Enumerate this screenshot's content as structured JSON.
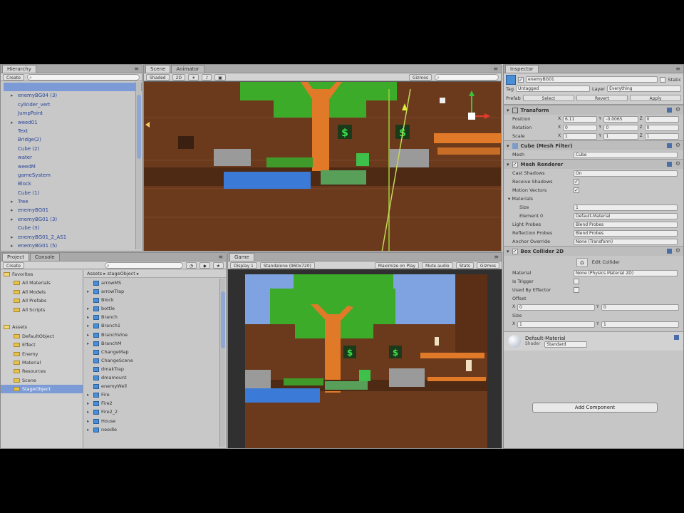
{
  "hierarchy": {
    "tab": "Hierarchy",
    "create": "Create",
    "search_placeholder": "",
    "items": [
      {
        "label": "",
        "arrow": false,
        "selected": true
      },
      {
        "label": "enemyBG04 (3)",
        "arrow": true,
        "selected": false
      },
      {
        "label": "cylinder_vert",
        "arrow": false,
        "selected": false
      },
      {
        "label": "JumpPoint",
        "arrow": false,
        "selected": false
      },
      {
        "label": "weed01",
        "arrow": true,
        "selected": false
      },
      {
        "label": "Text",
        "arrow": false,
        "selected": false
      },
      {
        "label": "Bridge(2)",
        "arrow": false,
        "selected": false
      },
      {
        "label": "Cube (2)",
        "arrow": false,
        "selected": false
      },
      {
        "label": "water",
        "arrow": false,
        "selected": false
      },
      {
        "label": "weedM",
        "arrow": false,
        "selected": false
      },
      {
        "label": "gameSystem",
        "arrow": false,
        "selected": false
      },
      {
        "label": "Block",
        "arrow": false,
        "selected": false
      },
      {
        "label": "Cube (1)",
        "arrow": false,
        "selected": false
      },
      {
        "label": "Tree",
        "arrow": true,
        "selected": false
      },
      {
        "label": "enemyBG01",
        "arrow": true,
        "selected": false
      },
      {
        "label": "enemyBG01 (3)",
        "arrow": true,
        "selected": false
      },
      {
        "label": "Cube (3)",
        "arrow": false,
        "selected": false
      },
      {
        "label": "enemyBG01_2_AS1",
        "arrow": true,
        "selected": false
      },
      {
        "label": "enemyBG01 (5)",
        "arrow": true,
        "selected": false
      }
    ]
  },
  "scene": {
    "tabs": [
      "Scene",
      "Animator"
    ],
    "shading": "Shaded",
    "mode_2d": "2D",
    "gizmos": "Gizmos"
  },
  "project": {
    "tabs": [
      "Project",
      "Console"
    ],
    "create": "Create",
    "favorites": [
      {
        "label": "Favorites",
        "level": 0,
        "selected": false
      },
      {
        "label": "All Materials",
        "level": 1,
        "selected": false
      },
      {
        "label": "All Models",
        "level": 1,
        "selected": false
      },
      {
        "label": "All Prefabs",
        "level": 1,
        "selected": false
      },
      {
        "label": "All Scripts",
        "level": 1,
        "selected": false
      },
      {
        "label": "",
        "level": 0,
        "selected": false
      },
      {
        "label": "Assets",
        "level": 0,
        "selected": false
      },
      {
        "label": "DefaultObject",
        "level": 1,
        "selected": false
      },
      {
        "label": "Effect",
        "level": 1,
        "selected": false
      },
      {
        "label": "Enemy",
        "level": 1,
        "selected": false
      },
      {
        "label": "Material",
        "level": 1,
        "selected": false
      },
      {
        "label": "Resources",
        "level": 1,
        "selected": false
      },
      {
        "label": "Scene",
        "level": 1,
        "selected": false
      },
      {
        "label": "StageObject",
        "level": 1,
        "selected": true
      }
    ],
    "breadcrumb": "Assets ▸ stageObject ▸",
    "assets": [
      {
        "label": "arrowMS",
        "arrow": false
      },
      {
        "label": "arrowTrap",
        "arrow": true
      },
      {
        "label": "Block",
        "arrow": false
      },
      {
        "label": "bottle",
        "arrow": true
      },
      {
        "label": "Branch",
        "arrow": true
      },
      {
        "label": "Branch1",
        "arrow": true
      },
      {
        "label": "BranchVine",
        "arrow": true
      },
      {
        "label": "BranchM",
        "arrow": true
      },
      {
        "label": "ChangeMap",
        "arrow": false
      },
      {
        "label": "ChangeScene",
        "arrow": false
      },
      {
        "label": "dmakTrap",
        "arrow": false
      },
      {
        "label": "dmamount",
        "arrow": false
      },
      {
        "label": "enemyWell",
        "arrow": false
      },
      {
        "label": "Fire",
        "arrow": true
      },
      {
        "label": "Fire2",
        "arrow": true
      },
      {
        "label": "Fire2_2",
        "arrow": true
      },
      {
        "label": "House",
        "arrow": true
      },
      {
        "label": "needle",
        "arrow": true
      }
    ]
  },
  "game": {
    "tab": "Game",
    "display": "Display 1",
    "aspect": "Standalone (960x720)",
    "toggles": [
      "Maximize on Play",
      "Mute audio",
      "Stats",
      "Gizmos"
    ]
  },
  "inspector": {
    "tab": "Inspector",
    "object_name": "enemyBG01",
    "static_label": "Static",
    "tag_label": "Tag",
    "tag_value": "Untagged",
    "layer_label": "Layer",
    "layer_value": "Everything",
    "prefab_label": "Prefab",
    "prefab_buttons": [
      "Select",
      "Revert",
      "Apply"
    ],
    "transform": {
      "title": "Transform",
      "rows": [
        {
          "label": "Position",
          "x": "6.11",
          "y": "-0.0065",
          "z": "0"
        },
        {
          "label": "Rotation",
          "x": "0",
          "y": "0",
          "z": "0"
        },
        {
          "label": "Scale",
          "x": "1",
          "y": "1",
          "z": "1"
        }
      ]
    },
    "mesh_filter": {
      "title": "Cube (Mesh Filter)",
      "mesh_label": "Mesh",
      "mesh_value": "Cube"
    },
    "mesh_renderer": {
      "title": "Mesh Renderer",
      "cast_shadows_label": "Cast Shadows",
      "cast_shadows_value": "On",
      "receive_shadows_label": "Receive Shadows",
      "motion_vectors_label": "Motion Vectors",
      "materials_label": "Materials",
      "size_label": "Size",
      "size_value": "1",
      "element_label": "Element 0",
      "element_value": "Default-Material",
      "light_probes_label": "Light Probes",
      "light_probes_value": "Blend Probes",
      "reflection_probes_label": "Reflection Probes",
      "reflection_probes_value": "Blend Probes",
      "anchor_label": "Anchor Override",
      "anchor_value": "None (Transform)"
    },
    "box_collider": {
      "title": "Box Collider 2D",
      "edit_label": "Edit Collider",
      "material_label": "Material",
      "material_value": "None (Physics Material 2D)",
      "trigger_label": "Is Trigger",
      "effector_label": "Used By Effector",
      "offset_label": "Offset",
      "offset_x": "0",
      "offset_y": "0",
      "size_label": "Size",
      "size_x": "1",
      "size_y": "1"
    },
    "material": {
      "title": "Default-Material",
      "shader_label": "Shader",
      "shader_value": "Standard"
    },
    "add_component": "Add Component"
  },
  "colors": {
    "dirt": "#6b3a1d",
    "leaves": "#3cab2a",
    "trunk": "#e07a28",
    "water": "#3b7ad6",
    "sky": "#7fa3e0",
    "stone": "#9a9a9a",
    "selection": "#7c9bd6"
  }
}
